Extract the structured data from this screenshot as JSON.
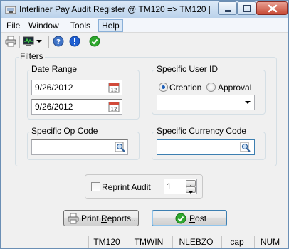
{
  "window": {
    "title": "Interliner Pay Audit Register @ TM120 => TM120 [..."
  },
  "menu": {
    "items": [
      "File",
      "Window",
      "Tools",
      "Help"
    ]
  },
  "toolbar": {
    "icons": [
      "print-icon",
      "monitor-icon",
      "dropdown-arrow-icon",
      "help-icon",
      "info-icon",
      "check-icon"
    ]
  },
  "filters": {
    "legend": "Filters",
    "date_range": {
      "label": "Date Range",
      "from": "9/26/2012",
      "to": "9/26/2012"
    },
    "user_id": {
      "label": "Specific User ID",
      "options": [
        "Creation",
        "Approval"
      ],
      "selected": "Creation",
      "value": ""
    },
    "op_code": {
      "label": "Specific Op Code",
      "value": ""
    },
    "currency_code": {
      "label": "Specific Currency Code",
      "value": ""
    }
  },
  "reprint": {
    "label_prefix": "Reprint ",
    "label_accel": "A",
    "label_suffix": "udit",
    "checked": false,
    "count": "1"
  },
  "buttons": {
    "print_prefix": "Print ",
    "print_accel": "R",
    "print_suffix": "eports...",
    "post_accel": "P",
    "post_suffix": "ost"
  },
  "status": {
    "cells": [
      "TM120",
      "TMWIN",
      "NLEBZO",
      "cap",
      "NUM"
    ]
  },
  "colors": {
    "accent": "#1d5fb8",
    "post_green": "#2ea82e",
    "close_red": "#c74a36"
  }
}
